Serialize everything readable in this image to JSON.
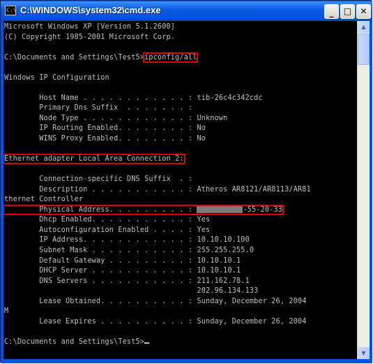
{
  "window": {
    "title": "C:\\WINDOWS\\system32\\cmd.exe",
    "icon": "console-icon",
    "icon_glyph": "C:\\"
  },
  "titlebar_buttons": {
    "minimize": "_",
    "maximize": "□",
    "close": "✕"
  },
  "console": {
    "lines": [
      "Microsoft Windows XP [Version 5.1.2600]",
      "(C) Copyright 1985-2001 Microsoft Corp.",
      "",
      "C:\\Documents and Settings\\Test5>",
      "",
      "Windows IP Configuration",
      "",
      "        Host Name . . . . . . . . . . . . : tib-26c4c342cdc",
      "        Primary Dns Suffix  . . . . . . . :",
      "        Node Type . . . . . . . . . . . . : Unknown",
      "        IP Routing Enabled. . . . . . . . : No",
      "        WINS Proxy Enabled. . . . . . . . : No",
      "",
      "",
      "",
      "        Connection-specific DNS Suffix  . :",
      "        Description . . . . . . . . . . . : Atheros AR8121/AR8113/AR81",
      "thernet Controller",
      "",
      "        Dhcp Enabled. . . . . . . . . . . : Yes",
      "        Autoconfiguration Enabled . . . . : Yes",
      "        IP Address. . . . . . . . . . . . : 10.10.10.100",
      "        Subnet Mask . . . . . . . . . . . : 255.255.255.0",
      "        Default Gateway . . . . . . . . . : 10.10.10.1",
      "        DHCP Server . . . . . . . . . . . : 10.10.10.1",
      "        DNS Servers . . . . . . . . . . . : 211.162.78.1",
      "                                            202.96.134.133",
      "        Lease Obtained. . . . . . . . . . : Sunday, December 26, 2004",
      "M",
      "        Lease Expires . . . . . . . . . . : Sunday, December 26, 2004",
      "",
      "C:\\Documents and Settings\\Test5>"
    ],
    "typed_command": "ipconfig/all",
    "adapter_header": "Ethernet adapter Local Area Connection 2:",
    "physical_address_label": "        Physical Address. . . . . . . . . : ",
    "physical_address_visible": "-55-20-33"
  },
  "scrollbar": {
    "up_arrow": "▲",
    "down_arrow": "▼"
  }
}
